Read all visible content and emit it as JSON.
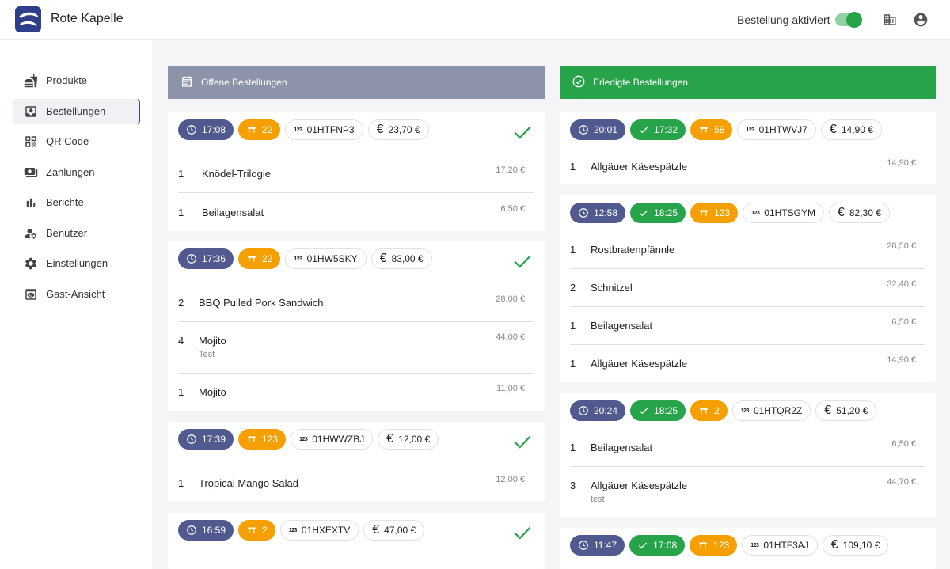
{
  "app": {
    "title": "Rote Kapelle",
    "order_toggle_label": "Bestellung aktiviert",
    "order_toggle_on": true,
    "accent": "#27a449",
    "brand": "#2f3e8a"
  },
  "sidebar": {
    "items": [
      {
        "label": "Produkte",
        "icon": "products-icon"
      },
      {
        "label": "Bestellungen",
        "icon": "orders-icon",
        "active": true
      },
      {
        "label": "QR Code",
        "icon": "qr-code-icon"
      },
      {
        "label": "Zahlungen",
        "icon": "payments-icon"
      },
      {
        "label": "Berichte",
        "icon": "reports-icon"
      },
      {
        "label": "Benutzer",
        "icon": "users-icon"
      },
      {
        "label": "Einstellungen",
        "icon": "settings-icon"
      },
      {
        "label": "Gast-Ansicht",
        "icon": "guest-view-icon"
      }
    ]
  },
  "open": {
    "title": "Offene Bestellungen",
    "orders": [
      {
        "time": "17:08",
        "table": "22",
        "id": "01HTFNP3",
        "total": "23,70 €",
        "items": [
          {
            "qty": "1",
            "name": "Knödel-Trilogie",
            "price": "17,20 €"
          },
          {
            "qty": "1",
            "name": "Beilagensalat",
            "price": "6,50 €"
          }
        ]
      },
      {
        "time": "17:36",
        "table": "22",
        "id": "01HW5SKY",
        "total": "83,00 €",
        "items": [
          {
            "qty": "2",
            "name": "BBQ Pulled Pork Sandwich",
            "price": "28,00 €"
          },
          {
            "qty": "4",
            "name": "Mojito",
            "note": "Test",
            "price": "44,00 €"
          },
          {
            "qty": "1",
            "name": "Mojito",
            "price": "11,00 €"
          }
        ]
      },
      {
        "time": "17:39",
        "table": "123",
        "id": "01HWWZBJ",
        "total": "12,00 €",
        "items": [
          {
            "qty": "1",
            "name": "Tropical Mango Salad",
            "price": "12,00 €"
          }
        ]
      },
      {
        "time": "16:59",
        "table": "2",
        "id": "01HXEXTV",
        "total": "47,00 €",
        "items": []
      }
    ]
  },
  "done": {
    "title": "Erledigte Bestellungen",
    "orders": [
      {
        "time": "20:01",
        "done_time": "17:32",
        "table": "58",
        "id": "01HTWVJ7",
        "total": "14,90 €",
        "items": [
          {
            "qty": "1",
            "name": "Allgäuer Käsespätzle",
            "price": "14,90 €"
          }
        ]
      },
      {
        "time": "12:58",
        "done_time": "18:25",
        "table": "123",
        "id": "01HTSGYM",
        "total": "82,30 €",
        "items": [
          {
            "qty": "1",
            "name": "Rostbratenpfännle",
            "price": "28,50 €"
          },
          {
            "qty": "2",
            "name": "Schnitzel",
            "price": "32,40 €"
          },
          {
            "qty": "1",
            "name": "Beilagensalat",
            "price": "6,50 €"
          },
          {
            "qty": "1",
            "name": "Allgäuer Käsespätzle",
            "price": "14,90 €"
          }
        ]
      },
      {
        "time": "20:24",
        "done_time": "18:25",
        "table": "2",
        "id": "01HTQR2Z",
        "total": "51,20 €",
        "items": [
          {
            "qty": "1",
            "name": "Beilagensalat",
            "price": "6,50 €"
          },
          {
            "qty": "3",
            "name": "Allgäuer Käsespätzle",
            "note": "test",
            "price": "44,70 €"
          }
        ]
      },
      {
        "time": "11:47",
        "done_time": "17:08",
        "table": "123",
        "id": "01HTF3AJ",
        "total": "109,10 €",
        "items": []
      }
    ]
  }
}
